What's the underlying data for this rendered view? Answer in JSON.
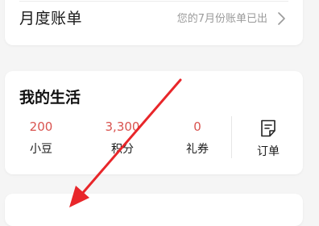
{
  "monthly_bill": {
    "title": "月度账单",
    "hint": "您的7月份账单已出"
  },
  "life": {
    "title": "我的生活",
    "stats": [
      {
        "value": "200",
        "label": "小豆"
      },
      {
        "value": "3,300",
        "label": "积分"
      },
      {
        "value": "0",
        "label": "礼券"
      }
    ],
    "order_label": "订单"
  },
  "colors": {
    "accent_red": "#d9534f",
    "arrow_red": "#e8262a"
  },
  "icons": {
    "chevron": "chevron-right-icon",
    "order": "order-document-icon"
  }
}
